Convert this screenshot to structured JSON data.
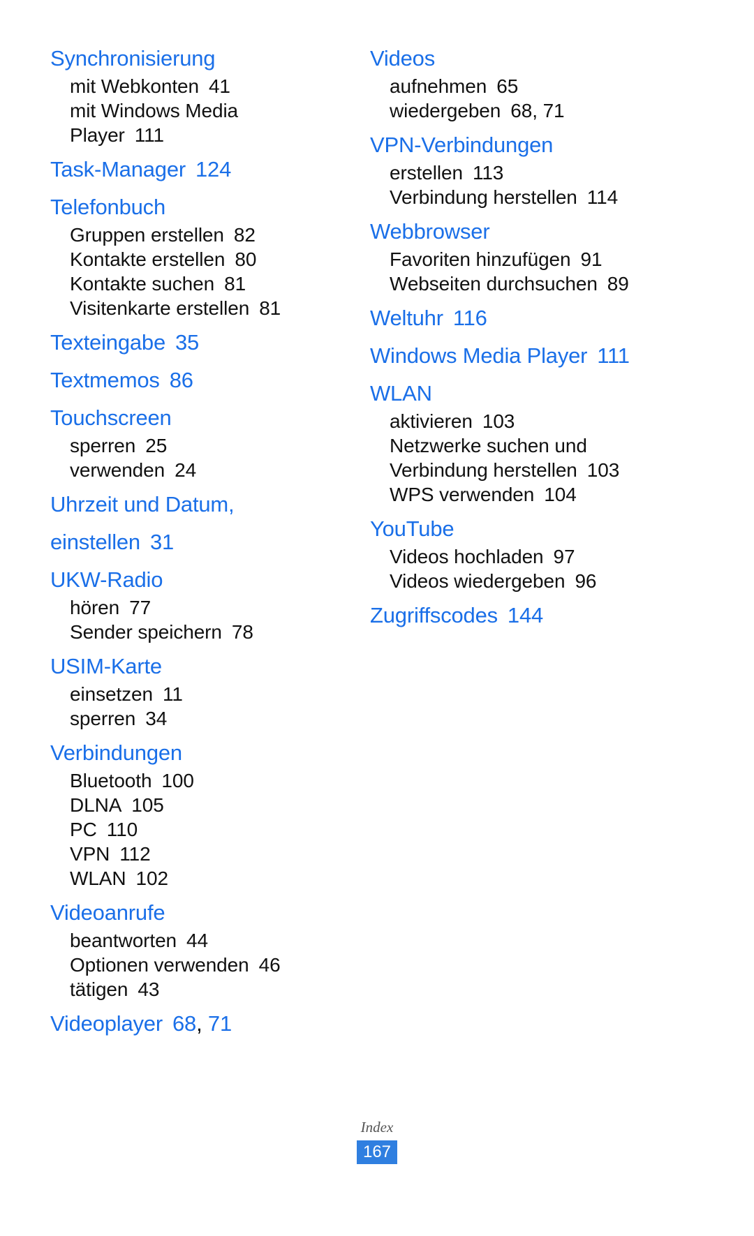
{
  "footer": {
    "label": "Index",
    "page_number": "167",
    "badge_color": "#2f7fe0"
  },
  "colors": {
    "heading": "#1a6fe8",
    "body": "#111111",
    "background": "#ffffff"
  },
  "left_column": [
    {
      "heading": "Synchronisierung",
      "heading_pages": "",
      "subs": [
        {
          "label": "mit Webkonten",
          "pages": "41"
        },
        {
          "label": "mit Windows Media",
          "pages": ""
        },
        {
          "label": "Player",
          "pages": "111"
        }
      ]
    },
    {
      "heading": "Task-Manager",
      "heading_pages": "124",
      "subs": []
    },
    {
      "heading": "Telefonbuch",
      "heading_pages": "",
      "subs": [
        {
          "label": "Gruppen erstellen",
          "pages": "82"
        },
        {
          "label": "Kontakte erstellen",
          "pages": "80"
        },
        {
          "label": "Kontakte suchen",
          "pages": "81"
        },
        {
          "label": "Visitenkarte erstellen",
          "pages": "81"
        }
      ]
    },
    {
      "heading": "Texteingabe",
      "heading_pages": "35",
      "subs": []
    },
    {
      "heading": "Textmemos",
      "heading_pages": "86",
      "subs": []
    },
    {
      "heading": "Touchscreen",
      "heading_pages": "",
      "subs": [
        {
          "label": "sperren",
          "pages": "25"
        },
        {
          "label": "verwenden",
          "pages": "24"
        }
      ]
    },
    {
      "heading": "Uhrzeit und Datum,",
      "heading_pages": "",
      "heading_line2": "einstellen",
      "heading_line2_pages": "31",
      "subs": []
    },
    {
      "heading": "UKW-Radio",
      "heading_pages": "",
      "subs": [
        {
          "label": "hören",
          "pages": "77"
        },
        {
          "label": "Sender speichern",
          "pages": "78"
        }
      ]
    },
    {
      "heading": "USIM-Karte",
      "heading_pages": "",
      "subs": [
        {
          "label": "einsetzen",
          "pages": "11"
        },
        {
          "label": "sperren",
          "pages": "34"
        }
      ]
    },
    {
      "heading": "Verbindungen",
      "heading_pages": "",
      "subs": [
        {
          "label": "Bluetooth",
          "pages": "100"
        },
        {
          "label": "DLNA",
          "pages": "105"
        },
        {
          "label": "PC",
          "pages": "110"
        },
        {
          "label": "VPN",
          "pages": "112"
        },
        {
          "label": "WLAN",
          "pages": "102"
        }
      ]
    },
    {
      "heading": "Videoanrufe",
      "heading_pages": "",
      "subs": [
        {
          "label": "beantworten",
          "pages": "44"
        },
        {
          "label": "Optionen verwenden",
          "pages": "46"
        },
        {
          "label": "tätigen",
          "pages": "43"
        }
      ]
    },
    {
      "heading": "Videoplayer",
      "heading_pages": "68, 71",
      "subs": []
    }
  ],
  "right_column": [
    {
      "heading": "Videos",
      "heading_pages": "",
      "subs": [
        {
          "label": "aufnehmen",
          "pages": "65"
        },
        {
          "label": "wiedergeben",
          "pages": "68, 71"
        }
      ]
    },
    {
      "heading": "VPN-Verbindungen",
      "heading_pages": "",
      "subs": [
        {
          "label": "erstellen",
          "pages": "113"
        },
        {
          "label": "Verbindung herstellen",
          "pages": "114"
        }
      ]
    },
    {
      "heading": "Webbrowser",
      "heading_pages": "",
      "subs": [
        {
          "label": "Favoriten hinzufügen",
          "pages": "91"
        },
        {
          "label": "Webseiten durchsuchen",
          "pages": "89"
        }
      ]
    },
    {
      "heading": "Weltuhr",
      "heading_pages": "116",
      "subs": []
    },
    {
      "heading": "Windows Media Player",
      "heading_pages": "111",
      "subs": []
    },
    {
      "heading": "WLAN",
      "heading_pages": "",
      "subs": [
        {
          "label": "aktivieren",
          "pages": "103"
        },
        {
          "label": "Netzwerke suchen und",
          "pages": ""
        },
        {
          "label": "Verbindung herstellen",
          "pages": "103"
        },
        {
          "label": "WPS verwenden",
          "pages": "104"
        }
      ]
    },
    {
      "heading": "YouTube",
      "heading_pages": "",
      "subs": [
        {
          "label": "Videos hochladen",
          "pages": "97"
        },
        {
          "label": "Videos wiedergeben",
          "pages": "96"
        }
      ]
    },
    {
      "heading": "Zugriffscodes",
      "heading_pages": "144",
      "subs": []
    }
  ]
}
